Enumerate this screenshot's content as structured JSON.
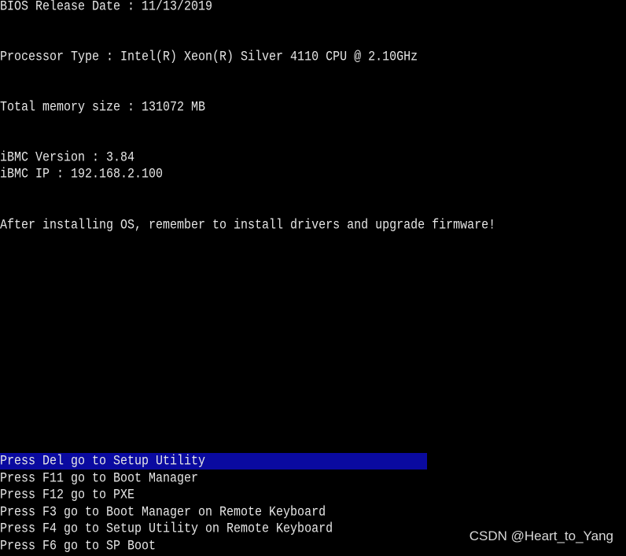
{
  "info": {
    "bios_release_date": "BIOS Release Date : 11/13/2019",
    "processor_type": "Processor Type : Intel(R) Xeon(R) Silver 4110 CPU @ 2.10GHz",
    "total_memory": "Total memory size : 131072 MB",
    "ibmc_version": "iBMC Version : 3.84",
    "ibmc_ip": "iBMC IP : 192.168.2.100",
    "notice": "After installing OS, remember to install drivers and upgrade firmware!"
  },
  "menu": [
    {
      "label": "Press Del go to Setup Utility",
      "selected": true
    },
    {
      "label": "Press F11 go to Boot Manager"
    },
    {
      "label": "Press F12 go to PXE"
    },
    {
      "label": "Press F3 go to Boot Manager on Remote Keyboard"
    },
    {
      "label": "Press F4 go to Setup Utility on Remote Keyboard"
    },
    {
      "label": "Press F6 go to SP Boot"
    }
  ],
  "watermark": "CSDN @Heart_to_Yang",
  "colors": {
    "highlight": "#0a0aa0",
    "text": "#e6e6e6",
    "background": "#000000"
  }
}
